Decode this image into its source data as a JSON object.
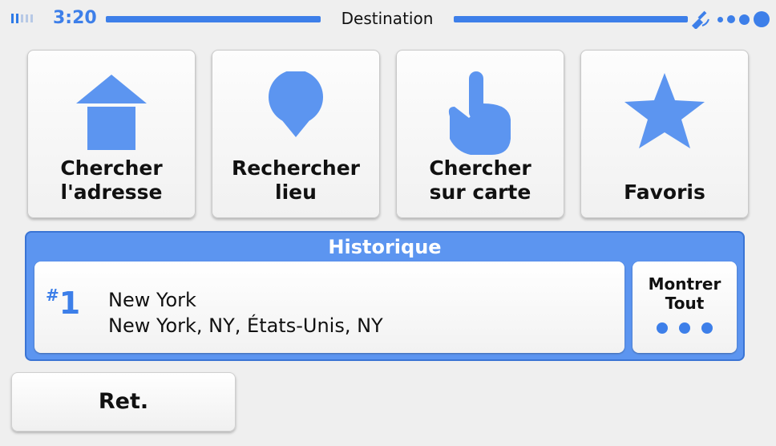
{
  "status": {
    "time": "3:20",
    "title": "Destination",
    "accent_color": "#3d7fe9",
    "signal_icon": "signal-bars-icon",
    "gps_icon": "satellite-icon",
    "dots_icon": "loading-dots-icon"
  },
  "tiles": [
    {
      "label": "Chercher\nl'adresse",
      "icon": "house-icon"
    },
    {
      "label": "Rechercher\nlieu",
      "icon": "map-pin-icon"
    },
    {
      "label": "Chercher\nsur carte",
      "icon": "pointing-hand-icon"
    },
    {
      "label": "Favoris",
      "icon": "star-icon"
    }
  ],
  "history": {
    "title": "Historique",
    "entries": [
      {
        "rank_hash": "#",
        "rank": "1",
        "line1": "New York",
        "line2": "New York, NY, États-Unis, NY"
      }
    ],
    "show_all_label": "Montrer\nTout",
    "panel_color": "#5c95f0"
  },
  "back": {
    "label": "Ret."
  }
}
